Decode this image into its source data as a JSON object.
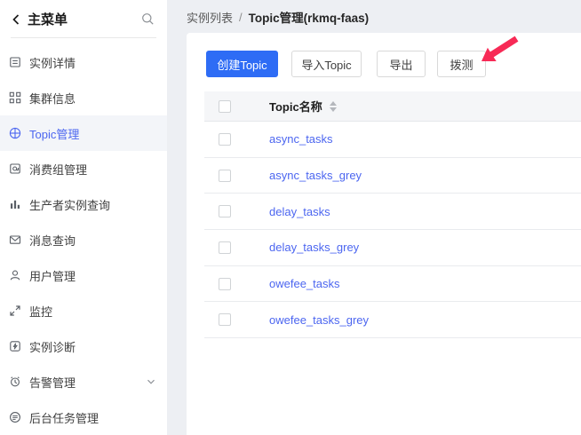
{
  "sidebar": {
    "title": "主菜单",
    "items": [
      {
        "label": "实例详情",
        "icon": "instance-detail",
        "active": false
      },
      {
        "label": "集群信息",
        "icon": "cluster-info",
        "active": false
      },
      {
        "label": "Topic管理",
        "icon": "topic-manage",
        "active": true
      },
      {
        "label": "消费组管理",
        "icon": "consumer-group",
        "active": false
      },
      {
        "label": "生产者实例查询",
        "icon": "producer-query",
        "active": false
      },
      {
        "label": "消息查询",
        "icon": "message-query",
        "active": false
      },
      {
        "label": "用户管理",
        "icon": "user-manage",
        "active": false
      },
      {
        "label": "监控",
        "icon": "monitor",
        "active": false
      },
      {
        "label": "实例诊断",
        "icon": "instance-diagnosis",
        "active": false
      },
      {
        "label": "告警管理",
        "icon": "alarm-manage",
        "active": false,
        "expandable": true
      },
      {
        "label": "后台任务管理",
        "icon": "background-task",
        "active": false
      }
    ]
  },
  "breadcrumb": {
    "parent": "实例列表",
    "separator": "/",
    "current": "Topic管理(rkmq-faas)"
  },
  "toolbar": {
    "create_label": "创建Topic",
    "import_label": "导入Topic",
    "export_label": "导出",
    "probe_label": "拨测"
  },
  "table": {
    "name_header": "Topic名称",
    "rows": [
      {
        "name": "async_tasks"
      },
      {
        "name": "async_tasks_grey"
      },
      {
        "name": "delay_tasks"
      },
      {
        "name": "delay_tasks_grey"
      },
      {
        "name": "owefee_tasks"
      },
      {
        "name": "owefee_tasks_grey"
      }
    ]
  },
  "colors": {
    "primary_blue": "#2e6cf5",
    "link_blue": "#4c66f0",
    "annotation_arrow": "#f72a56",
    "page_background": "#edeff3",
    "table_header_bg": "#f5f6f8"
  }
}
